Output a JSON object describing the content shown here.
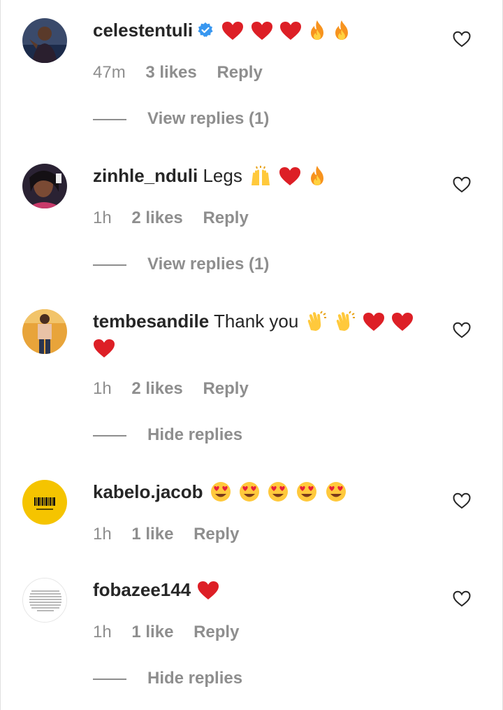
{
  "comments": [
    {
      "username": "celestentuli",
      "verified": true,
      "text": "",
      "emojis": [
        "heart",
        "heart",
        "heart",
        "fire",
        "fire"
      ],
      "time": "47m",
      "likes": "3 likes",
      "reply_label": "Reply",
      "replies_toggle": "View replies (1)"
    },
    {
      "username": "zinhle_nduli",
      "text": "Legs",
      "emojis": [
        "raised-hands",
        "heart",
        "fire"
      ],
      "time": "1h",
      "likes": "2 likes",
      "reply_label": "Reply",
      "replies_toggle": "View replies (1)"
    },
    {
      "username": "tembesandile",
      "text": "Thank you",
      "emojis": [
        "clap",
        "clap",
        "heart",
        "heart",
        "heart"
      ],
      "time": "1h",
      "likes": "2 likes",
      "reply_label": "Reply",
      "replies_toggle": "Hide replies"
    },
    {
      "username": "kabelo.jacob",
      "text": "",
      "emojis": [
        "heart-eyes",
        "heart-eyes",
        "heart-eyes",
        "heart-eyes",
        "heart-eyes"
      ],
      "time": "1h",
      "likes": "1 like",
      "reply_label": "Reply",
      "replies_toggle": ""
    },
    {
      "username": "fobazee144",
      "text": "",
      "emojis": [
        "heart"
      ],
      "time": "1h",
      "likes": "1 like",
      "reply_label": "Reply",
      "replies_toggle": "Hide replies"
    }
  ],
  "colors": {
    "text": "#262626",
    "meta": "#8e8e8e",
    "heart": "#ed1c24",
    "verified": "#3897f0"
  }
}
